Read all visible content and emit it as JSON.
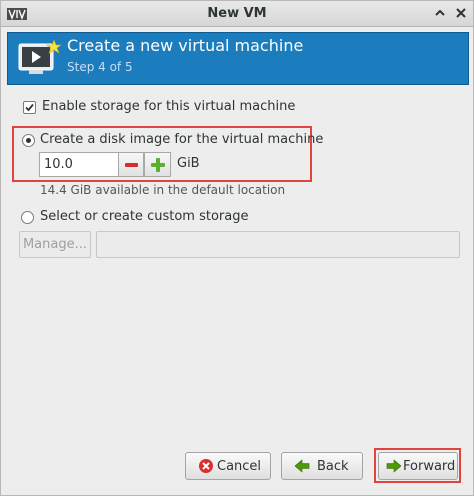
{
  "window": {
    "title": "New VM"
  },
  "header": {
    "heading": "Create a new virtual machine",
    "step": "Step 4 of 5"
  },
  "storage": {
    "enable_label": "Enable storage for this virtual machine",
    "enable_checked": true,
    "create_disk_label": "Create a disk image for the virtual machine",
    "create_disk_selected": true,
    "size_value": "10.0",
    "size_unit": "GiB",
    "available_text": "14.4 GiB available in the default location",
    "custom_label": "Select or create custom storage",
    "custom_selected": false,
    "manage_label": "Manage...",
    "path_value": ""
  },
  "buttons": {
    "cancel": "Cancel",
    "back": "Back",
    "forward": "Forward"
  },
  "colors": {
    "banner": "#1b7cbe",
    "highlight": "#e0443f",
    "minus": "#d32f2f",
    "plus": "#59b02c"
  },
  "icons": [
    "virt-manager-logo-icon",
    "collapse-up-icon",
    "close-icon",
    "new-vm-icon",
    "checkbox-checked-icon",
    "minus-icon",
    "plus-icon",
    "cancel-icon",
    "back-arrow-icon",
    "forward-arrow-icon"
  ]
}
